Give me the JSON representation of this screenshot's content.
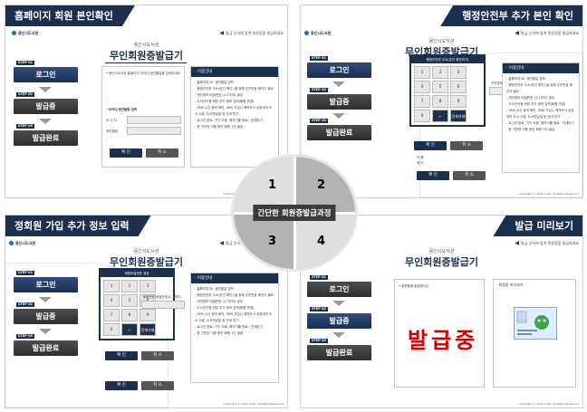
{
  "hub": {
    "label": "간단한 회원증발급과정",
    "n1": "1",
    "n2": "2",
    "n3": "3",
    "n4": "4"
  },
  "common": {
    "brand": "용인시도서관",
    "notice": "발급 순서에 맞게 회원증을 발급하세요",
    "service": "용인시도서관",
    "title": "무인회원증발급기",
    "copyright": "Copyright © 2021 YOGI. All Rights Reserved",
    "guide_title": "· 이용안내",
    "guide": [
      "- 홈페이지 ID, 생년월일 입력",
      "- 행정안전부 주소(본인 확인) 을 위해 주민번호 확인이 필요",
      "- 개인정보 비밀번호 (4-7자리) 생성",
      "- 도서관이용 위한 추가 정보 입력(회원 변경)",
      "- SMS 수신 동의 확인, SMS 가입시 예약도서 상호대차 도서 수령, 도서반납일 등 안내 받기",
      "- 로그인 완료, 기기 도움, 해지기를 종료 : 안내받기",
      "- 한 기관당 이용 중인 회원 1인 발급"
    ],
    "confirm": "확 인",
    "cancel": "취 소"
  },
  "q1": {
    "caption": "홈페이지 회원 본인확인",
    "form_intro": "• 용인시도서관 홈페이지 아이디/생년월일을 입력하세요",
    "form_head": "· 아이디/생년월일 입력",
    "id_label": "아 이 디",
    "birth_label": "생년월일",
    "login": "로그인",
    "issuing": "발급중",
    "done": "발급완료",
    "s1": "STEP 01",
    "s2": "STEP 02",
    "s3": "STEP 03"
  },
  "q2": {
    "caption": "행정안전부 추가 본인 확인",
    "keypad_title": "행정안전부 주소(본인 확인하기)",
    "keypad": [
      "1",
      "2",
      "3",
      "4",
      "5",
      "6",
      "7",
      "8",
      "9",
      "0",
      "←",
      "전체삭제"
    ],
    "input_label": "주민등록번호 앞자리",
    "name_label": "이  름",
    "date_label": "생  년"
  },
  "q3": {
    "caption": "정회원 가입 추가 정보 입력",
    "keypad_title": "회원비밀번호 생성",
    "keypad": [
      "1",
      "2",
      "3",
      "4",
      "5",
      "6",
      "7",
      "8",
      "9",
      "0",
      "←",
      "전체삭제"
    ],
    "input_label": "회원번호 비밀번호(4-7자리)"
  },
  "q4": {
    "caption": "발급 미리보기",
    "status_text": "발급중",
    "card_title": "· 회원증 미리보기",
    "intro": "• 회원증을 발급합니다"
  }
}
